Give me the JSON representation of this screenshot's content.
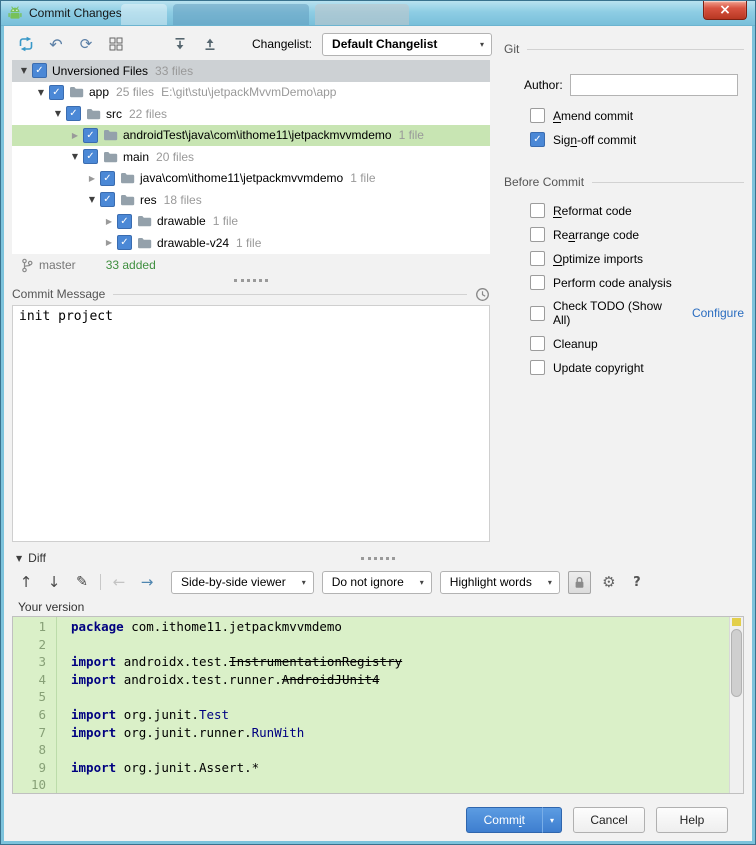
{
  "window": {
    "title": "Commit Changes"
  },
  "icons": {
    "close": "×",
    "undo": "↶",
    "refresh": "⟳",
    "dropdown": "▾",
    "tri_down": "▼",
    "tri_right": "▶",
    "arrow_up": "↑",
    "arrow_down": "↓",
    "arrow_left": "←",
    "arrow_right": "→",
    "pencil": "✎",
    "gear": "⚙",
    "help": "?",
    "check": "✓"
  },
  "toolbar": {
    "changelist_label": "Changelist:",
    "changelist_value": "Default Changelist"
  },
  "tree": {
    "rows": [
      {
        "level": 0,
        "arrow": "down",
        "checked": true,
        "selected": "gray",
        "folder": false,
        "label": "Unversioned Files",
        "count": "33 files",
        "path": ""
      },
      {
        "level": 1,
        "arrow": "down",
        "checked": true,
        "selected": "",
        "folder": true,
        "label": "app",
        "count": "25 files",
        "path": "E:\\git\\stu\\jetpackMvvmDemo\\app"
      },
      {
        "level": 2,
        "arrow": "down",
        "checked": true,
        "selected": "",
        "folder": true,
        "label": "src",
        "count": "22 files",
        "path": ""
      },
      {
        "level": 3,
        "arrow": "right",
        "checked": true,
        "selected": "green",
        "folder": true,
        "label": "androidTest\\java\\com\\ithome11\\jetpackmvvmdemo",
        "count": "1 file",
        "path": ""
      },
      {
        "level": 3,
        "arrow": "down",
        "checked": true,
        "selected": "",
        "folder": true,
        "label": "main",
        "count": "20 files",
        "path": ""
      },
      {
        "level": 4,
        "arrow": "right",
        "checked": true,
        "selected": "",
        "folder": true,
        "label": "java\\com\\ithome11\\jetpackmvvmdemo",
        "count": "1 file",
        "path": ""
      },
      {
        "level": 4,
        "arrow": "down",
        "checked": true,
        "selected": "",
        "folder": true,
        "label": "res",
        "count": "18 files",
        "path": ""
      },
      {
        "level": 5,
        "arrow": "right",
        "checked": true,
        "selected": "",
        "folder": true,
        "label": "drawable",
        "count": "1 file",
        "path": ""
      },
      {
        "level": 5,
        "arrow": "right",
        "checked": true,
        "selected": "",
        "folder": true,
        "label": "drawable-v24",
        "count": "1 file",
        "path": ""
      }
    ]
  },
  "status": {
    "branch": "master",
    "added": "33 added"
  },
  "commit_message": {
    "label": "Commit Message",
    "text": "init project"
  },
  "git_panel": {
    "section": "Git",
    "author_label": "Author:",
    "author_value": "",
    "options": [
      {
        "label": "Amend commit",
        "checked": false,
        "mnemonic": 0
      },
      {
        "label": "Sign-off commit",
        "checked": true,
        "mnemonic": 3
      }
    ]
  },
  "before_commit": {
    "section": "Before Commit",
    "options": [
      {
        "label": "Reformat code",
        "checked": false,
        "mnemonic": 0
      },
      {
        "label": "Rearrange code",
        "checked": false,
        "mnemonic": 2
      },
      {
        "label": "Optimize imports",
        "checked": false,
        "mnemonic": 0
      },
      {
        "label": "Perform code analysis",
        "checked": false,
        "mnemonic": -1
      },
      {
        "label": "Check TODO (Show All)",
        "checked": false,
        "mnemonic": -1,
        "link": "Configure"
      },
      {
        "label": "Cleanup",
        "checked": false,
        "mnemonic": -1
      },
      {
        "label": "Update copyright",
        "checked": false,
        "mnemonic": -1
      }
    ]
  },
  "diff": {
    "section": "Diff",
    "toolbar": {
      "viewer_dropdown": "Side-by-side viewer",
      "ignore_dropdown": "Do not ignore",
      "highlight_dropdown": "Highlight words"
    },
    "pane_title": "Your version",
    "lines": [
      {
        "num": "1",
        "segments": [
          {
            "t": "package ",
            "s": "kw"
          },
          {
            "t": "com.ithome11.jetpackmvvmdemo",
            "s": "p"
          }
        ]
      },
      {
        "num": "2",
        "segments": []
      },
      {
        "num": "3",
        "segments": [
          {
            "t": "import ",
            "s": "kw"
          },
          {
            "t": "androidx.test.",
            "s": "p"
          },
          {
            "t": "InstrumentationRegistry",
            "s": "del"
          }
        ]
      },
      {
        "num": "4",
        "segments": [
          {
            "t": "import ",
            "s": "kw"
          },
          {
            "t": "androidx.test.runner.",
            "s": "p"
          },
          {
            "t": "AndroidJUnit4",
            "s": "del"
          }
        ]
      },
      {
        "num": "5",
        "segments": []
      },
      {
        "num": "6",
        "segments": [
          {
            "t": "import ",
            "s": "kw"
          },
          {
            "t": "org.junit.",
            "s": "p"
          },
          {
            "t": "Test",
            "s": "cls"
          }
        ]
      },
      {
        "num": "7",
        "segments": [
          {
            "t": "import ",
            "s": "kw"
          },
          {
            "t": "org.junit.runner.",
            "s": "p"
          },
          {
            "t": "RunWith",
            "s": "cls"
          }
        ]
      },
      {
        "num": "8",
        "segments": []
      },
      {
        "num": "9",
        "segments": [
          {
            "t": "import ",
            "s": "kw"
          },
          {
            "t": "org.junit.Assert.*",
            "s": "p"
          }
        ]
      },
      {
        "num": "10",
        "segments": []
      }
    ]
  },
  "footer": {
    "commit": "Commit",
    "commit_mnemonic": 4,
    "cancel": "Cancel",
    "help": "Help"
  },
  "colors": {
    "accent_blue": "#3e7ecf",
    "added_green": "#3f8f3f",
    "diff_bg": "#daf0c8",
    "tree_selected_green": "#c8e5b3",
    "tree_selected_gray": "#cdd1d4",
    "keyword_navy": "#000080"
  }
}
